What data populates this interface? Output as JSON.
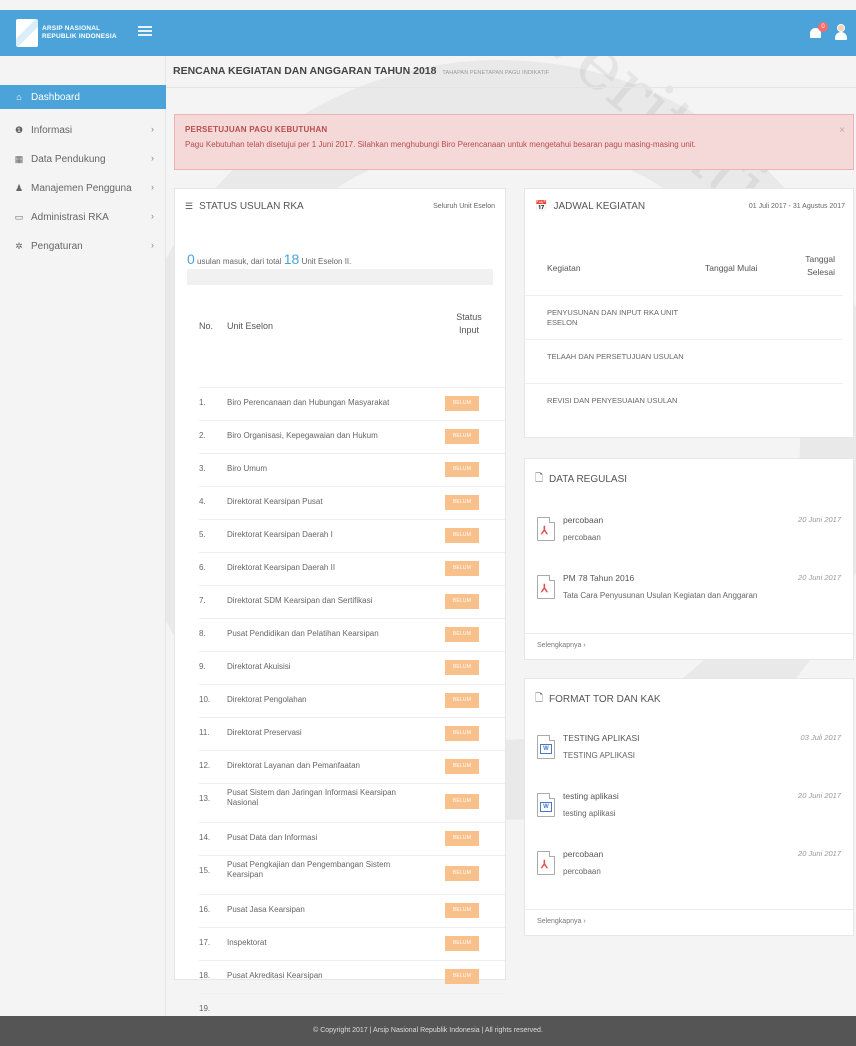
{
  "header": {
    "logo_text": "ARSIP NASIONAL\nREPUBLIK INDONESIA",
    "notification_count": "0",
    "color": "#4ba3d9"
  },
  "sidebar": {
    "items": [
      {
        "label": "Dashboard",
        "icon": "home-icon"
      },
      {
        "label": "Informasi",
        "icon": "info-icon"
      },
      {
        "label": "Data Pendukung",
        "icon": "table-icon"
      },
      {
        "label": "Manajemen Pengguna",
        "icon": "user-icon"
      },
      {
        "label": "Administrasi RKA",
        "icon": "folder-icon"
      },
      {
        "label": "Pengaturan",
        "icon": "gear-icon"
      }
    ]
  },
  "page": {
    "title": "RENCANA KEGIATAN DAN ANGGARAN TAHUN 2018",
    "subtitle": "TAHAPAN PENETAPAN PAGU INDIKATIF"
  },
  "alert": {
    "title": "PERSETUJUAN PAGU KEBUTUHAN",
    "text": "Pagu Kebutuhan telah disetujui per 1 Juni 2017. Silahkan menghubungi Biro Perencanaan untuk mengetahui besaran pagu masing-masing unit.",
    "close": "×"
  },
  "status_rka": {
    "title": "STATUS USULAN RKA",
    "scope": "Seluruh Unit Eselon",
    "submitted": "0",
    "progress_mid": "usulan masuk, dari total",
    "total": "18",
    "progress_end": "Unit Eselon II.",
    "progress_fraction": 0,
    "col_no": "No.",
    "col_unit": "Unit Eselon",
    "col_status": "Status Input",
    "rows": [
      {
        "no": "1.",
        "unit": "Biro Perencanaan dan Hubungan Masyarakat",
        "status": "BELUM"
      },
      {
        "no": "2.",
        "unit": "Biro Organisasi, Kepegawaian dan Hukum",
        "status": "BELUM"
      },
      {
        "no": "3.",
        "unit": "Biro Umum",
        "status": "BELUM"
      },
      {
        "no": "4.",
        "unit": "Direktorat Kearsipan Pusat",
        "status": "BELUM"
      },
      {
        "no": "5.",
        "unit": "Direktorat Kearsipan Daerah I",
        "status": "BELUM"
      },
      {
        "no": "6.",
        "unit": "Direktorat Kearsipan Daerah II",
        "status": "BELUM"
      },
      {
        "no": "7.",
        "unit": "Direktorat SDM Kearsipan dan Sertifikasi",
        "status": "BELUM"
      },
      {
        "no": "8.",
        "unit": "Pusat Pendidikan dan Pelatihan Kearsipan",
        "status": "BELUM"
      },
      {
        "no": "9.",
        "unit": "Direktorat Akuisisi",
        "status": "BELUM"
      },
      {
        "no": "10.",
        "unit": "Direktorat Pengolahan",
        "status": "BELUM"
      },
      {
        "no": "11.",
        "unit": "Direktorat Preservasi",
        "status": "BELUM"
      },
      {
        "no": "12.",
        "unit": "Direktorat Layanan dan Pemanfaatan",
        "status": "BELUM"
      },
      {
        "no": "13.",
        "unit": "Pusat Sistem dan Jaringan Informasi Kearsipan Nasional",
        "status": "BELUM"
      },
      {
        "no": "14.",
        "unit": "Pusat Data dan Informasi",
        "status": "BELUM"
      },
      {
        "no": "15.",
        "unit": "Pusat Pengkajian dan Pengembangan Sistem Kearsipan",
        "status": "BELUM"
      },
      {
        "no": "16.",
        "unit": "Pusat Jasa Kearsipan",
        "status": "BELUM"
      },
      {
        "no": "17.",
        "unit": "Inspektorat",
        "status": "BELUM"
      },
      {
        "no": "18.",
        "unit": "Pusat Akreditasi Kearsipan",
        "status": "BELUM"
      },
      {
        "no": "19.",
        "unit": "",
        "status": ""
      }
    ]
  },
  "jadwal": {
    "title": "JADWAL KEGIATAN",
    "range": "01 Juli 2017 - 31 Agustus 2017",
    "col_kegiatan": "Kegiatan",
    "col_mulai": "Tanggal Mulai",
    "col_selesai": "Tanggal Selesai",
    "rows": [
      {
        "name": "PENYUSUNAN DAN INPUT RKA UNIT ESELON"
      },
      {
        "name": "TELAAH DAN PERSETUJUAN USULAN"
      },
      {
        "name": "REVISI DAN PENYESUAIAN USULAN"
      }
    ]
  },
  "regulasi": {
    "title": "DATA REGULASI",
    "items": [
      {
        "title": "percobaan",
        "desc": "percobaan",
        "date": "20 Juni 2017",
        "type": "pdf-icon"
      },
      {
        "title": "PM 78 Tahun 2016",
        "desc": "Tata Cara Penyusunan Usulan Kegiatan dan Anggaran",
        "date": "20 Juni 2017",
        "type": "pdf-icon"
      }
    ],
    "more": "Selengkapnya ›"
  },
  "tor": {
    "title": "FORMAT TOR DAN KAK",
    "items": [
      {
        "title": "TESTING APLIKASI",
        "desc": "TESTING APLIKASI",
        "date": "03 Juli 2017",
        "type": "word-icon"
      },
      {
        "title": "testing aplikasi",
        "desc": "testing aplikasi",
        "date": "20 Juni 2017",
        "type": "word-icon"
      },
      {
        "title": "percobaan",
        "desc": "percobaan",
        "date": "20 Juni 2017",
        "type": "pdf-icon"
      }
    ],
    "more": "Selengkapnya ›"
  },
  "footer": {
    "text": "© Copyright 2017  |  Arsip Nasional Republik Indonesia  |  All rights reserved."
  },
  "watermark": "veritatis"
}
